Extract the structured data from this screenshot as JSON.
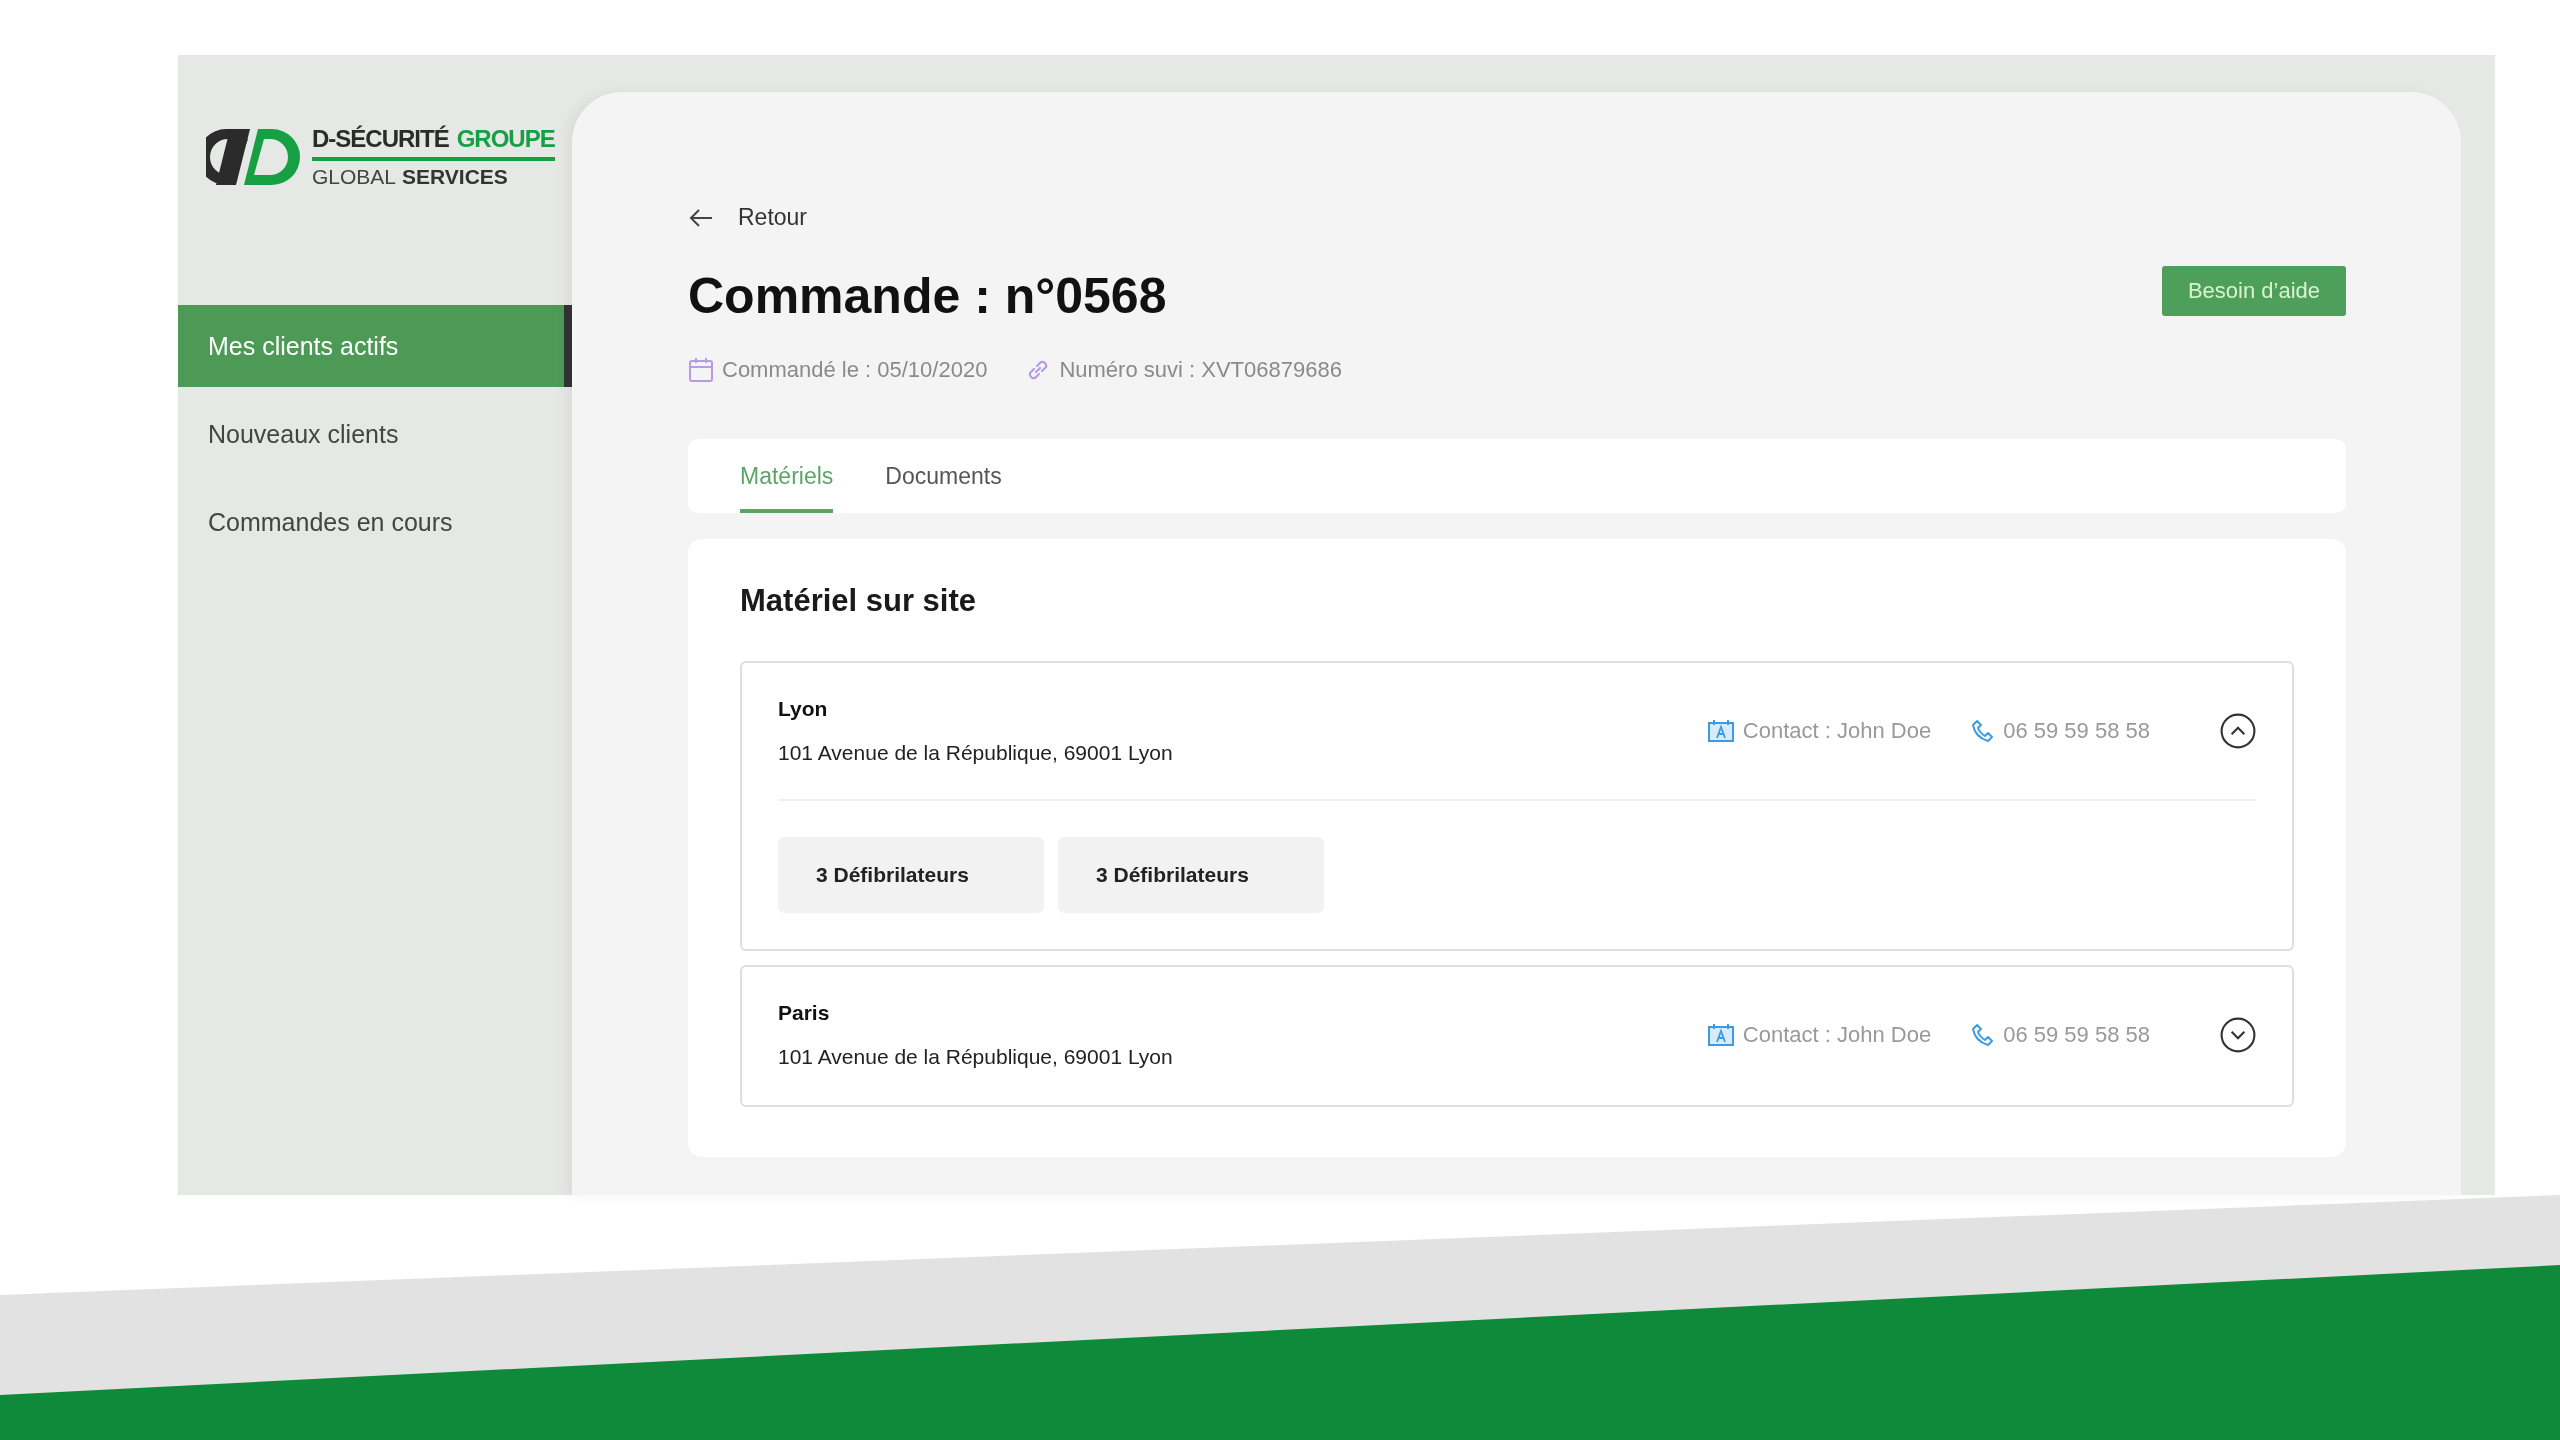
{
  "sidebar": {
    "logo": {
      "brand": "D-SÉCURITÉ",
      "brand_accent": "GROUPE",
      "tagline": "GLOBAL",
      "tagline_bold": "SERVICES"
    },
    "items": [
      {
        "label": "Mes clients actifs",
        "selected": true
      },
      {
        "label": "Nouveaux clients",
        "selected": false
      },
      {
        "label": "Commandes en cours",
        "selected": false
      }
    ]
  },
  "header": {
    "back": "Retour",
    "title": "Commande : n°0568",
    "help_button": "Besoin d’aide",
    "ordered": "Commandé le : 05/10/2020",
    "tracking": "Numéro suvi : XVT06879686"
  },
  "tabs": [
    {
      "label": "Matériels",
      "selected": true
    },
    {
      "label": "Documents",
      "selected": false
    }
  ],
  "section": {
    "title": "Matériel sur site",
    "sites": [
      {
        "name": "Lyon",
        "address": "101 Avenue de la République, 69001 Lyon",
        "contact": "Contact : John Doe",
        "phone": "06 59 59 58 58",
        "expanded": true,
        "items": [
          "3 Défibrilateurs",
          "3 Défibrilateurs"
        ]
      },
      {
        "name": "Paris",
        "address": "101 Avenue de la République, 69001 Lyon",
        "contact": "Contact : John Doe",
        "phone": "06 59 59 58 58",
        "expanded": false
      }
    ]
  }
}
